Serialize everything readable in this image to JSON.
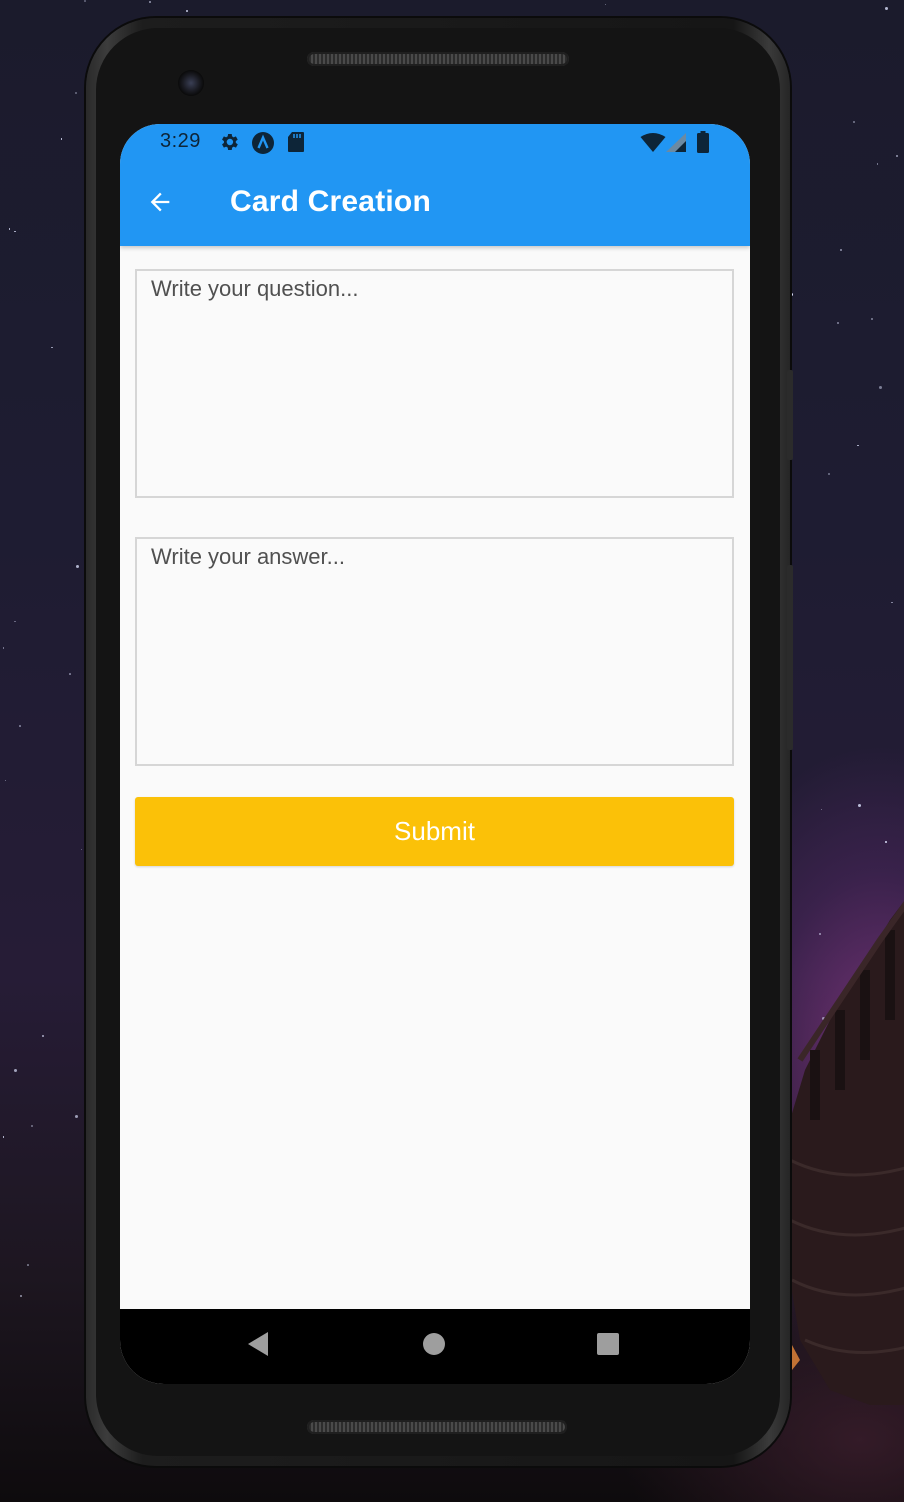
{
  "status_bar": {
    "time": "3:29",
    "left_icons": [
      "settings-icon",
      "app-notification-icon",
      "sd-card-icon"
    ],
    "right_icons": [
      "wifi-icon",
      "signal-icon",
      "battery-icon"
    ]
  },
  "app_bar": {
    "back_icon": "arrow-left-icon",
    "title": "Card Creation",
    "color": "#2196f3"
  },
  "form": {
    "question": {
      "value": "",
      "placeholder": "Write your question..."
    },
    "answer": {
      "value": "",
      "placeholder": "Write your answer..."
    },
    "submit_label": "Submit",
    "submit_color": "#fbc108"
  },
  "nav_bar": {
    "buttons": [
      "back-triangle-icon",
      "home-circle-icon",
      "recents-square-icon"
    ]
  }
}
